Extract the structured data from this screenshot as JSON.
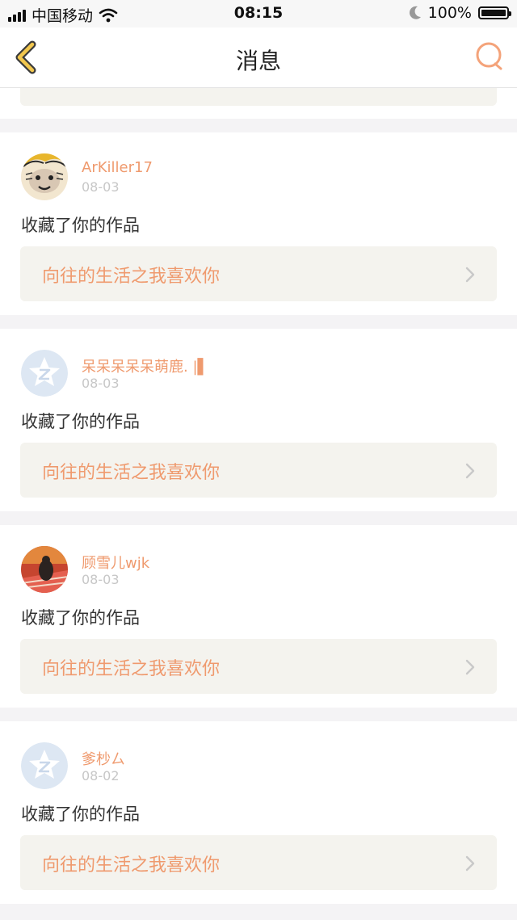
{
  "status_bar": {
    "carrier": "中国移动",
    "time": "08:15",
    "battery": "100%",
    "battery_level": 1.0
  },
  "nav": {
    "title": "消息",
    "icons": [
      "back-chevron-icon",
      "search-icon"
    ],
    "accent_color": "#f2b84b",
    "search_color": "#f4a37a"
  },
  "colors": {
    "username": "#ef9a6e",
    "work_title": "#ef9a6e",
    "date": "#c7c7c7",
    "work_bg": "#f4f3ee",
    "page_bg": "#f4f3f5"
  },
  "messages": [
    {
      "user": "ArKiller17",
      "date": "08-03",
      "action": "收藏了你的作品",
      "work_title": "向往的生活之我喜欢你",
      "avatar": "cartoon-avatar"
    },
    {
      "user": "呆呆呆呆呆萌鹿. |▌",
      "date": "08-03",
      "action": "收藏了你的作品",
      "work_title": "向往的生活之我喜欢你",
      "avatar": "default-avatar"
    },
    {
      "user": "顾雪儿wjk",
      "date": "08-03",
      "action": "收藏了你的作品",
      "work_title": "向往的生活之我喜欢你",
      "avatar": "photo-avatar"
    },
    {
      "user": "爹杪ㄙ",
      "date": "08-02",
      "action": "收藏了你的作品",
      "work_title": "向往的生活之我喜欢你",
      "avatar": "default-avatar"
    }
  ]
}
